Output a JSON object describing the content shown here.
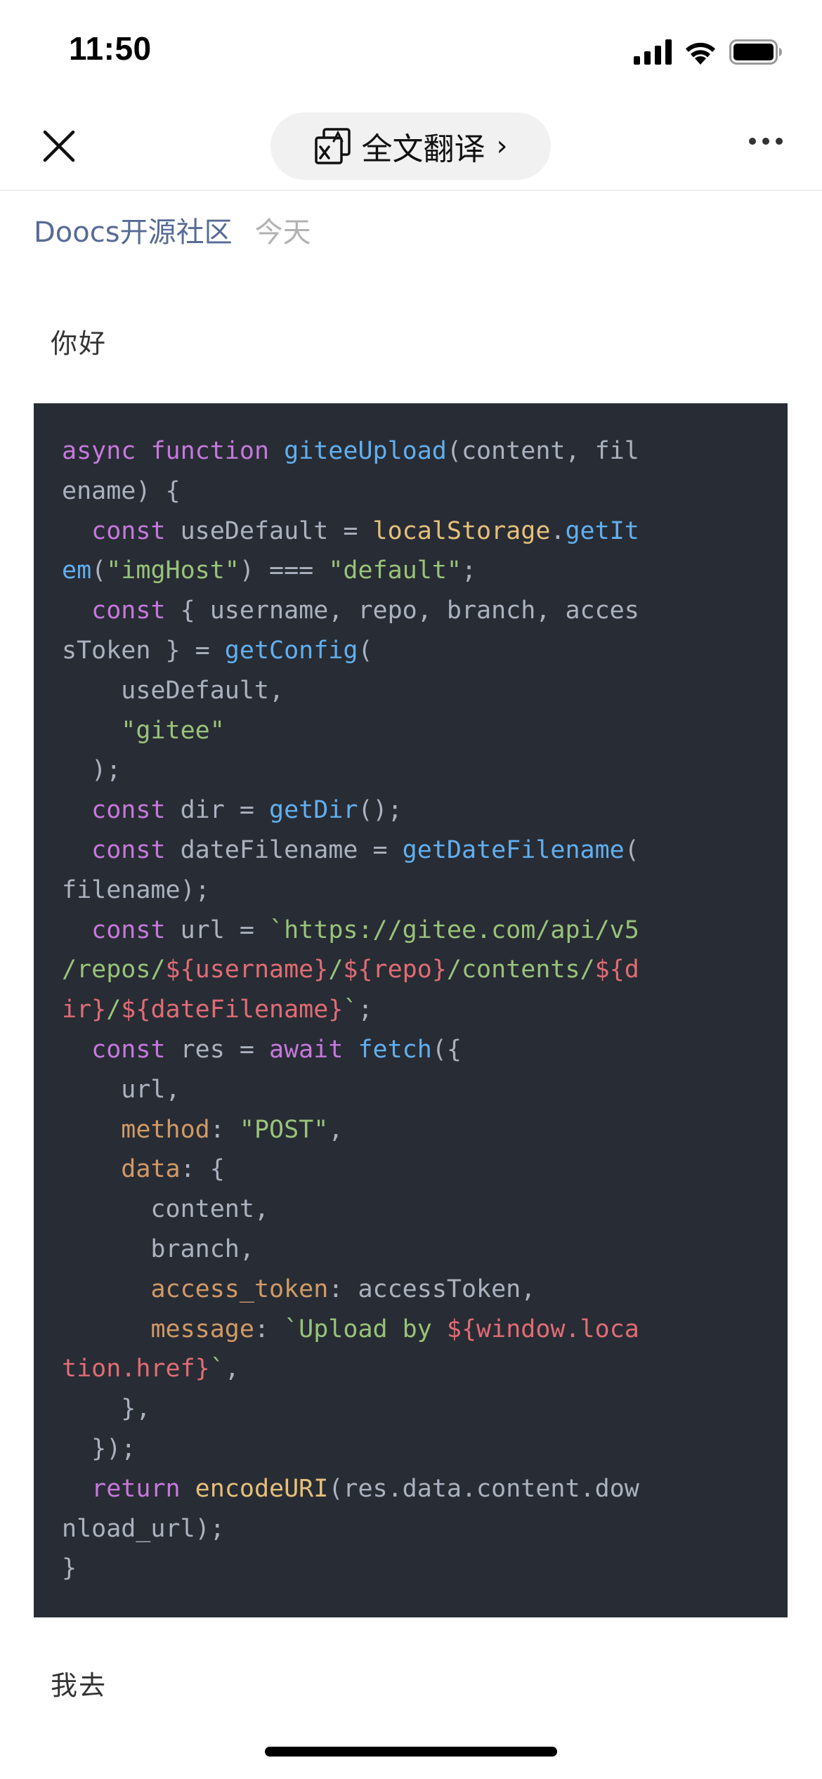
{
  "status_bar": {
    "time": "11:50"
  },
  "nav": {
    "close_icon": "close-icon",
    "translate_icon": "translate-icon",
    "translate_label": "全文翻译",
    "translate_chevron": "›",
    "more_icon": "more-icon"
  },
  "article": {
    "author": "Doocs开源社区",
    "date": "今天",
    "paragraph_top": "你好",
    "paragraph_bottom": "我去"
  },
  "code": {
    "lines": [
      [
        [
          "kw",
          "async "
        ],
        [
          "kw",
          "function "
        ],
        [
          "fn",
          "giteeUpload"
        ],
        [
          "pl",
          "(content, fil"
        ]
      ],
      [
        [
          "pl",
          "ename) {"
        ]
      ],
      [
        [
          "pl",
          "  "
        ],
        [
          "kw",
          "const "
        ],
        [
          "pl",
          "useDefault = "
        ],
        [
          "var",
          "localStorage"
        ],
        [
          "pl",
          "."
        ],
        [
          "fn",
          "getIt"
        ]
      ],
      [
        [
          "fn",
          "em"
        ],
        [
          "pl",
          "("
        ],
        [
          "str",
          "\"imgHost\""
        ],
        [
          "pl",
          ") === "
        ],
        [
          "str",
          "\"default\""
        ],
        [
          "pl",
          ";"
        ]
      ],
      [
        [
          "pl",
          "  "
        ],
        [
          "kw",
          "const "
        ],
        [
          "pl",
          "{ username, repo, branch, acces"
        ]
      ],
      [
        [
          "pl",
          "sToken } = "
        ],
        [
          "fn",
          "getConfig"
        ],
        [
          "pl",
          "("
        ]
      ],
      [
        [
          "pl",
          "    useDefault,"
        ]
      ],
      [
        [
          "pl",
          "    "
        ],
        [
          "str",
          "\"gitee\""
        ]
      ],
      [
        [
          "pl",
          "  );"
        ]
      ],
      [
        [
          "pl",
          "  "
        ],
        [
          "kw",
          "const "
        ],
        [
          "pl",
          "dir = "
        ],
        [
          "fn",
          "getDir"
        ],
        [
          "pl",
          "();"
        ]
      ],
      [
        [
          "pl",
          "  "
        ],
        [
          "kw",
          "const "
        ],
        [
          "pl",
          "dateFilename = "
        ],
        [
          "fn",
          "getDateFilename"
        ],
        [
          "pl",
          "("
        ]
      ],
      [
        [
          "pl",
          "filename);"
        ]
      ],
      [
        [
          "pl",
          "  "
        ],
        [
          "kw",
          "const "
        ],
        [
          "pl",
          "url = "
        ],
        [
          "str",
          "`https://gitee.com/api/v5"
        ]
      ],
      [
        [
          "str",
          "/repos/"
        ],
        [
          "tmpl",
          "${username}"
        ],
        [
          "str",
          "/"
        ],
        [
          "tmpl",
          "${repo}"
        ],
        [
          "str",
          "/contents/"
        ],
        [
          "tmpl",
          "${d"
        ]
      ],
      [
        [
          "tmpl",
          "ir}"
        ],
        [
          "str",
          "/"
        ],
        [
          "tmpl",
          "${dateFilename}"
        ],
        [
          "str",
          "`"
        ],
        [
          "pl",
          ";"
        ]
      ],
      [
        [
          "pl",
          "  "
        ],
        [
          "kw",
          "const "
        ],
        [
          "pl",
          "res = "
        ],
        [
          "kw",
          "await "
        ],
        [
          "fn",
          "fetch"
        ],
        [
          "pl",
          "({"
        ]
      ],
      [
        [
          "pl",
          "    url,"
        ]
      ],
      [
        [
          "pl",
          "    "
        ],
        [
          "prop",
          "method"
        ],
        [
          "pl",
          ": "
        ],
        [
          "str",
          "\"POST\""
        ],
        [
          "pl",
          ","
        ]
      ],
      [
        [
          "pl",
          "    "
        ],
        [
          "prop",
          "data"
        ],
        [
          "pl",
          ": {"
        ]
      ],
      [
        [
          "pl",
          "      content,"
        ]
      ],
      [
        [
          "pl",
          "      branch,"
        ]
      ],
      [
        [
          "pl",
          "      "
        ],
        [
          "prop",
          "access_token"
        ],
        [
          "pl",
          ": accessToken,"
        ]
      ],
      [
        [
          "pl",
          "      "
        ],
        [
          "prop",
          "message"
        ],
        [
          "pl",
          ": "
        ],
        [
          "str",
          "`Upload by "
        ],
        [
          "tmpl",
          "${window.loca"
        ]
      ],
      [
        [
          "tmpl",
          "tion.href}"
        ],
        [
          "str",
          "`"
        ],
        [
          "pl",
          ","
        ]
      ],
      [
        [
          "pl",
          "    },"
        ]
      ],
      [
        [
          "pl",
          "  });"
        ]
      ],
      [
        [
          "pl",
          "  "
        ],
        [
          "kw",
          "return "
        ],
        [
          "var",
          "encodeURI"
        ],
        [
          "pl",
          "(res.data.content.dow"
        ]
      ],
      [
        [
          "pl",
          "nload_url);"
        ]
      ],
      [
        [
          "pl",
          "}"
        ]
      ]
    ]
  },
  "colors": {
    "link_blue": "#576b95",
    "code_bg": "#282c34",
    "keyword": "#c678dd",
    "function": "#61afef",
    "string": "#98c379",
    "variable": "#e5c07b",
    "property": "#d19a66",
    "template": "#e06c75"
  }
}
